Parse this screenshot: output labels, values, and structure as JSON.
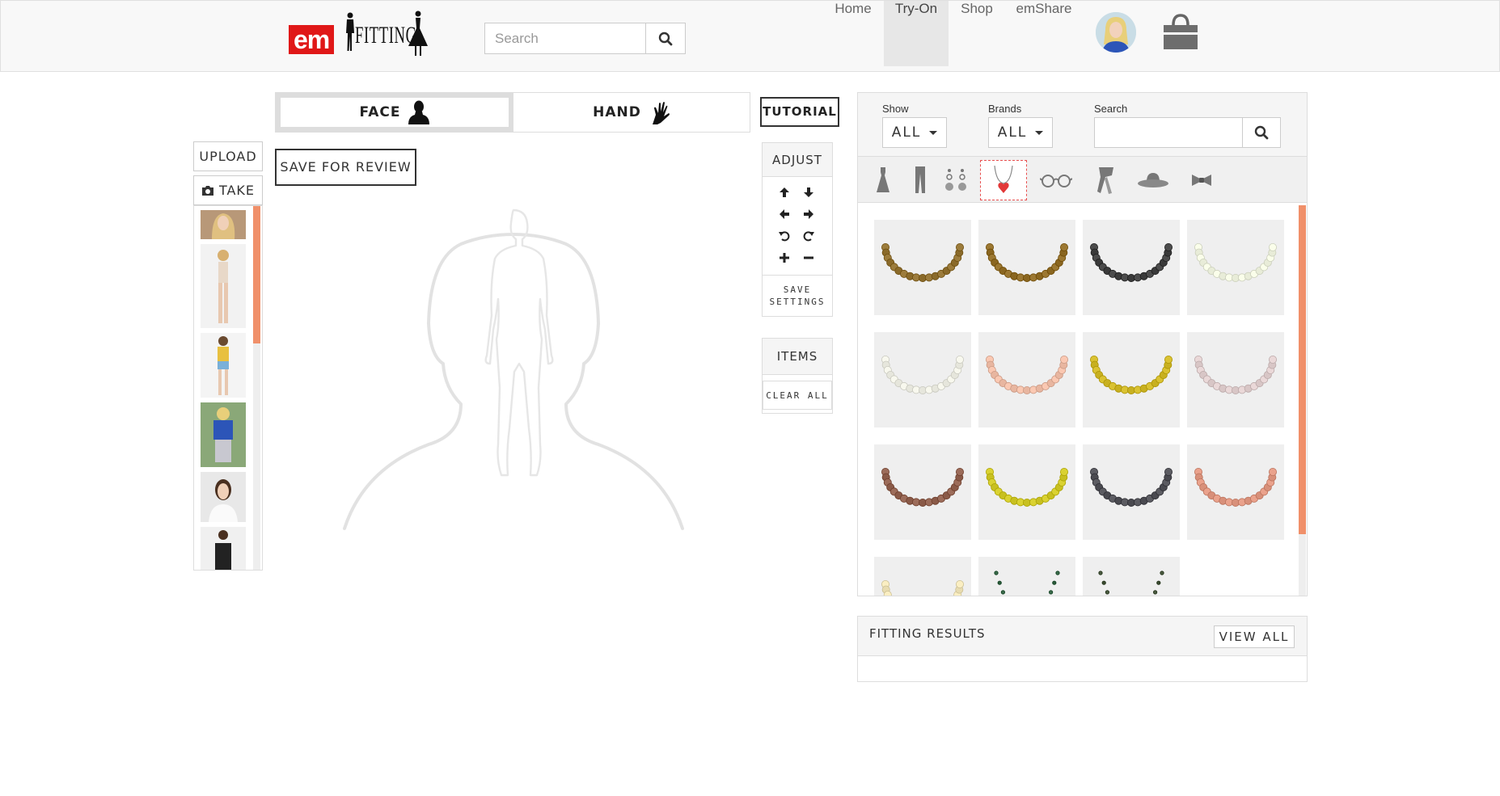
{
  "navbar": {
    "logo_em": "em",
    "logo_fitting": "FITTING",
    "search_placeholder": "Search",
    "links": [
      {
        "label": "Home"
      },
      {
        "label": "Try-On",
        "active": true
      },
      {
        "label": "Shop"
      },
      {
        "label": "emShare"
      }
    ],
    "icons": {
      "search": "search-icon",
      "avatar": "user-avatar",
      "cart": "shopping-bag-icon"
    }
  },
  "left_strip": {
    "upload_label": "UPLOAD",
    "take_label": "TAKE",
    "take_icon": "camera-icon",
    "photo_count_visible": 6
  },
  "mode_toggle": {
    "face_label": "FACE",
    "hand_label": "HAND",
    "selected": "FACE"
  },
  "save_review_label": "SAVE FOR REVIEW",
  "controls": {
    "tutorial_label": "TUTORIAL",
    "adjust_title": "ADJUST",
    "adjust_icons": [
      "arrow-up-icon",
      "arrow-down-icon",
      "arrow-left-icon",
      "arrow-right-icon",
      "rotate-left-icon",
      "rotate-right-icon",
      "plus-icon",
      "minus-icon"
    ],
    "save_settings_line1": "SAVE",
    "save_settings_line2": "SETTINGS",
    "items_title": "ITEMS",
    "clear_all_label": "CLEAR ALL"
  },
  "product_panel": {
    "show_label": "Show",
    "show_value": "ALL",
    "brands_label": "Brands",
    "brands_value": "ALL",
    "search_label": "Search",
    "search_value": "",
    "categories": [
      "dress-icon",
      "pants-icon",
      "earrings-icon",
      "necklace-icon",
      "glasses-icon",
      "scarf-icon",
      "hat-icon",
      "bowtie-icon"
    ],
    "selected_category": "necklace-icon",
    "items": [
      {
        "color": "#8a6a2a"
      },
      {
        "color": "#8a6620"
      },
      {
        "color": "#3a3a3a"
      },
      {
        "color": "#e8ecd8"
      },
      {
        "color": "#e6e6dc"
      },
      {
        "color": "#e8b6a0"
      },
      {
        "color": "#c8b020"
      },
      {
        "color": "#d8c6c6"
      },
      {
        "color": "#8a5a48"
      },
      {
        "color": "#c8c020"
      },
      {
        "color": "#4a4a50"
      },
      {
        "color": "#d8907a"
      },
      {
        "color": "#e8dcb0"
      },
      {
        "color": "#2a5a3a"
      },
      {
        "color": "#3a4a30"
      }
    ],
    "scroll_fraction": 0.84
  },
  "fitting_results": {
    "title": "FITTING RESULTS",
    "view_all_label": "VIEW ALL"
  }
}
